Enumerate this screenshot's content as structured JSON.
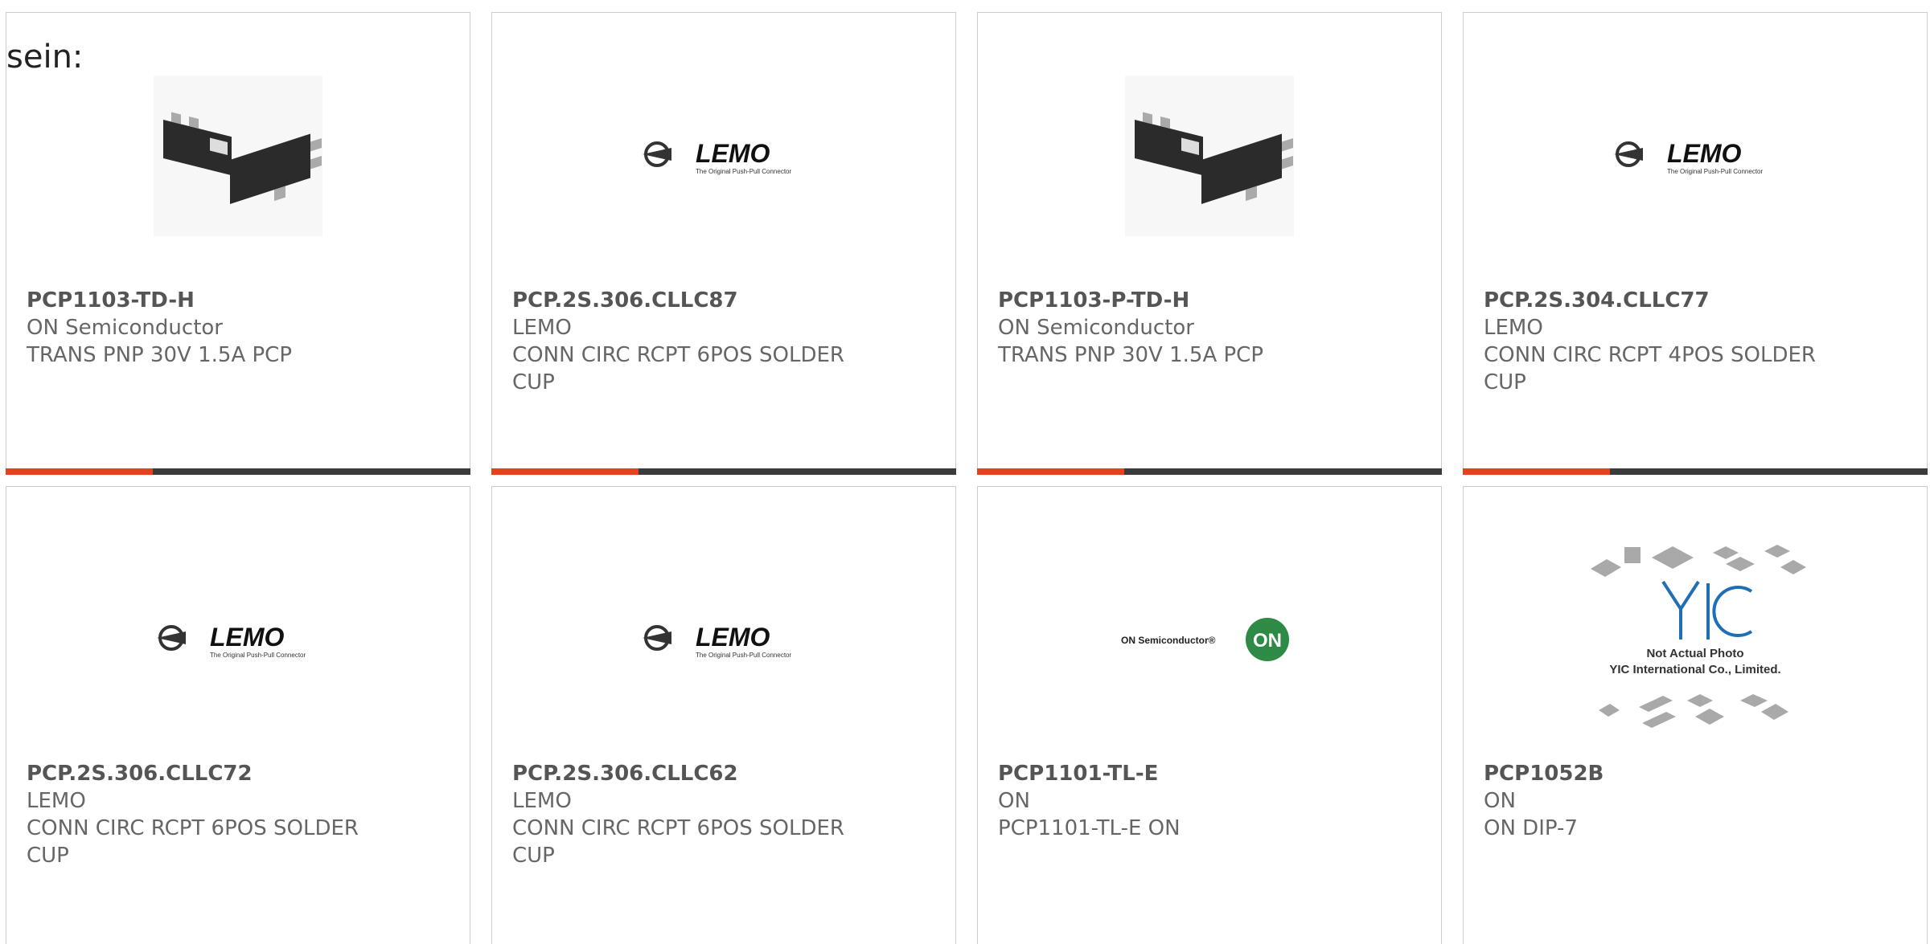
{
  "intro": "sein:",
  "colors": {
    "accent": "#e8401c",
    "bar": "#3b3b3b",
    "border": "#cccccc",
    "text": "#666666"
  },
  "products": [
    {
      "part_number": "PCP1103-TD-H",
      "manufacturer": "ON Semiconductor",
      "description": "TRANS PNP 30V 1.5A PCP",
      "image": "transistor-package-photo"
    },
    {
      "part_number": "PCP.2S.306.CLLC87",
      "manufacturer": "LEMO",
      "description": "CONN CIRC RCPT 6POS SOLDER CUP",
      "image": "lemo-logo",
      "logo_text": "LEMO",
      "logo_tagline": "The Original Push-Pull Connector"
    },
    {
      "part_number": "PCP1103-P-TD-H",
      "manufacturer": "ON Semiconductor",
      "description": "TRANS PNP 30V 1.5A PCP",
      "image": "transistor-package-photo"
    },
    {
      "part_number": "PCP.2S.304.CLLC77",
      "manufacturer": "LEMO",
      "description": "CONN CIRC RCPT 4POS SOLDER CUP",
      "image": "lemo-logo",
      "logo_text": "LEMO",
      "logo_tagline": "The Original Push-Pull Connector"
    },
    {
      "part_number": "PCP.2S.306.CLLC72",
      "manufacturer": "LEMO",
      "description": "CONN CIRC RCPT 6POS SOLDER CUP",
      "image": "lemo-logo",
      "logo_text": "LEMO",
      "logo_tagline": "The Original Push-Pull Connector"
    },
    {
      "part_number": "PCP.2S.306.CLLC62",
      "manufacturer": "LEMO",
      "description": "CONN CIRC RCPT 6POS SOLDER CUP",
      "image": "lemo-logo",
      "logo_text": "LEMO",
      "logo_tagline": "The Original Push-Pull Connector"
    },
    {
      "part_number": "PCP1101-TL-E",
      "manufacturer": "ON",
      "description": "PCP1101-TL-E ON",
      "image": "on-semiconductor-logo",
      "logo_text": "ON Semiconductor®",
      "logo_badge": "ON"
    },
    {
      "part_number": "PCP1052B",
      "manufacturer": "ON",
      "description": "ON DIP-7",
      "image": "yic-placeholder",
      "logo_line1": "Not Actual Photo",
      "logo_line2": "YIC International Co., Limited."
    }
  ]
}
